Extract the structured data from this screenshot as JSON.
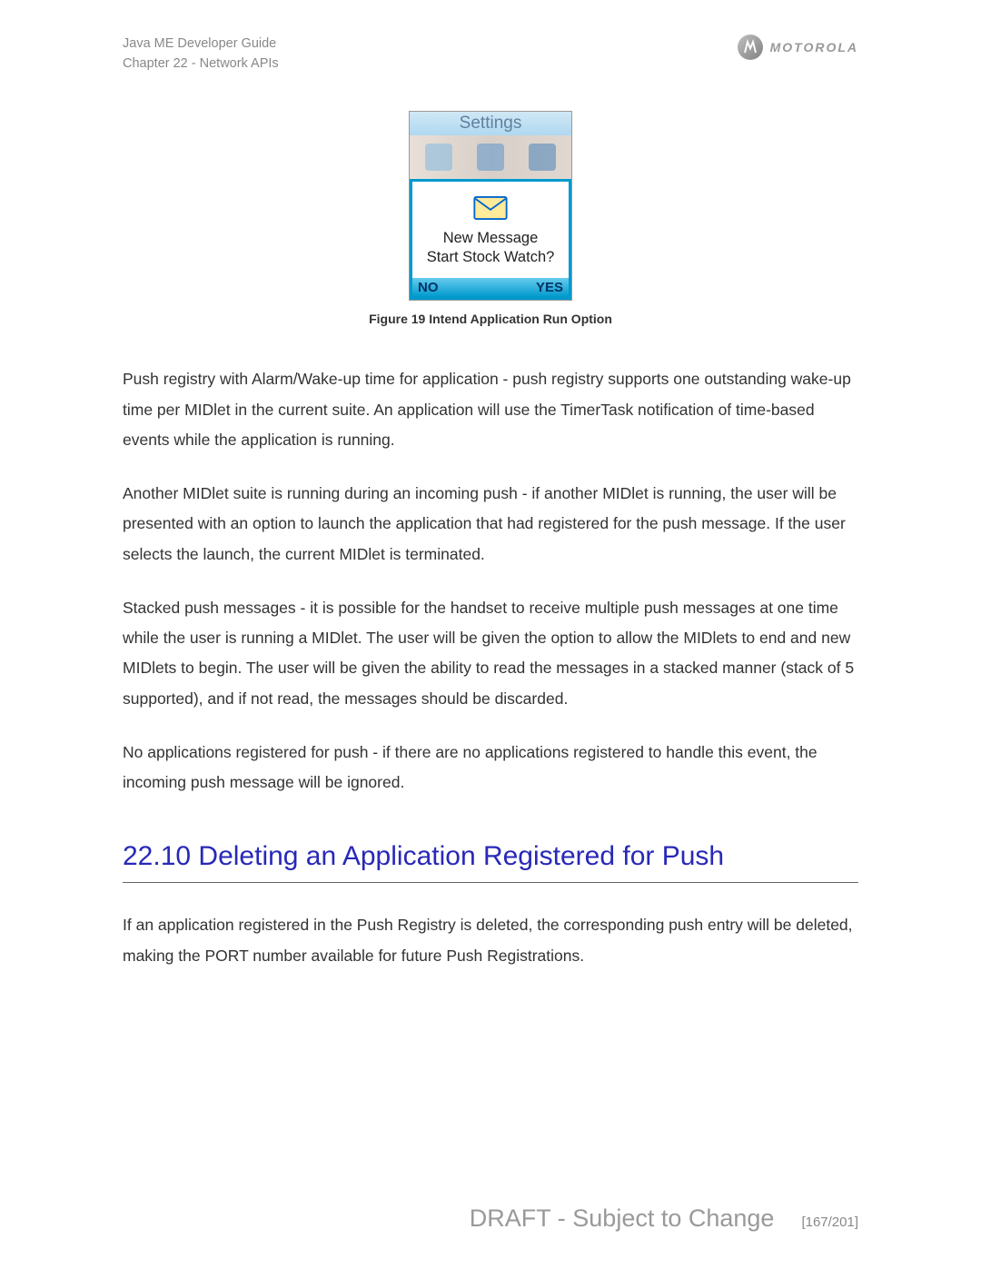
{
  "header": {
    "guide_title": "Java ME Developer Guide",
    "chapter": "Chapter 22 - Network APIs",
    "brand": "MOTOROLA"
  },
  "phone": {
    "title": "Settings",
    "dialog_line1": "New Message",
    "dialog_line2": "Start Stock Watch?",
    "button_no": "NO",
    "button_yes": "YES"
  },
  "figure_caption": "Figure 19 Intend Application Run Option",
  "paragraphs": {
    "p1": "Push registry with Alarm/Wake-up time for application - push registry supports one outstanding wake-up time per MIDlet in the current suite. An application will use the TimerTask notification of time-based events while the application is running.",
    "p2": "Another MIDlet suite is running during an incoming push - if another MIDlet is running, the user will be presented with an option to launch the application that had registered for the push message. If the user selects the launch, the current MIDlet is terminated.",
    "p3": "Stacked push messages - it is possible for the handset to receive multiple push messages at one time while the user is running a MIDlet. The user will be given the option to allow the MIDlets to end and new MIDlets to begin. The user will be given the ability to read the messages in a stacked manner (stack of 5 supported), and if not read, the messages should be discarded.",
    "p4": "No applications registered for push - if there are no applications registered to handle this event, the incoming push message will be ignored.",
    "p5": "If an application registered in the Push Registry is deleted, the corresponding push entry will be deleted, making the PORT number available for future Push Registrations."
  },
  "section_heading": "22.10 Deleting an Application Registered for Push",
  "footer": {
    "draft": "DRAFT - Subject to Change",
    "page": "[167/201]"
  }
}
